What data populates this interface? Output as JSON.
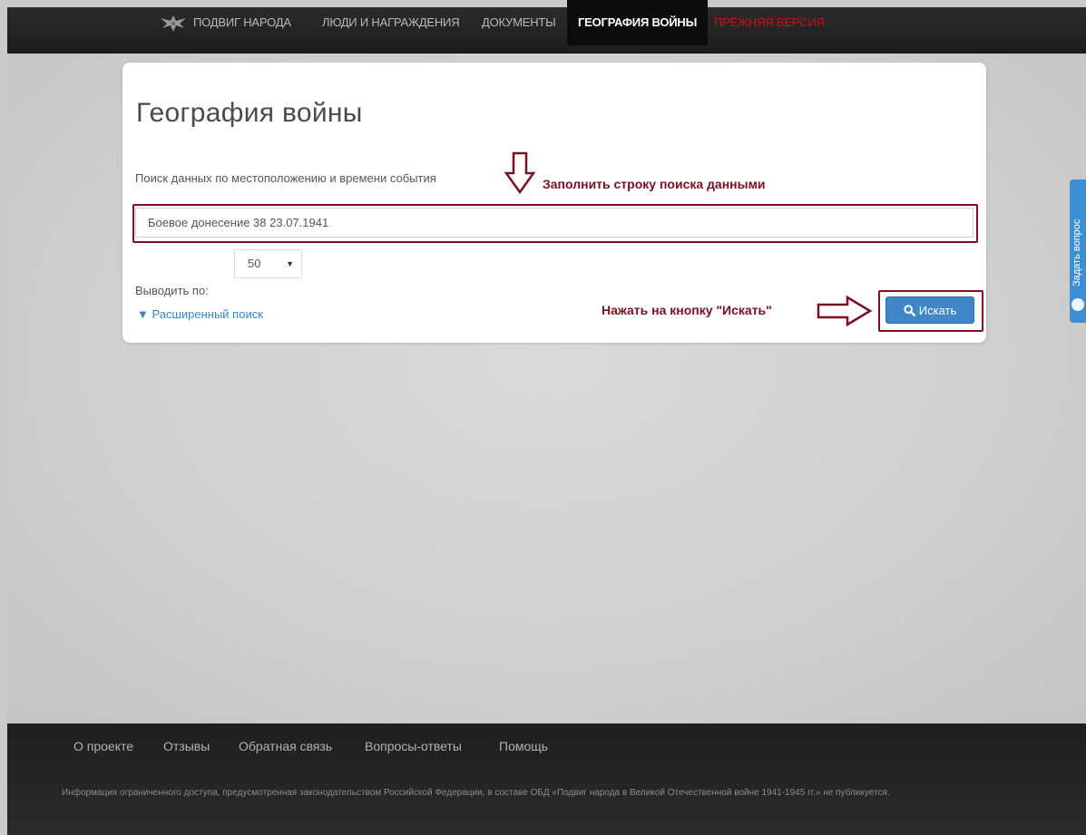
{
  "nav": {
    "items": [
      {
        "label": "ПОДВИГ НАРОДА"
      },
      {
        "label": "ЛЮДИ И НАГРАЖДЕНИЯ"
      },
      {
        "label": "ДОКУМЕНТЫ"
      },
      {
        "label": "ГЕОГРАФИЯ ВОЙНЫ"
      },
      {
        "label": "ПРЕЖНЯЯ ВЕРСИЯ"
      }
    ],
    "active_color": "#0c0c0c",
    "legacy_color": "#c0141b"
  },
  "main": {
    "title": "География войны",
    "search_label": "Поиск данных по местоположению и времени события",
    "search_value": "Боевое донесение 38 23.07.1941",
    "per_page_label": "Выводить по:",
    "per_page_value": "50",
    "advanced_search": "▼ Расширенный поиск",
    "search_button": "Искать"
  },
  "annotations": {
    "fill_hint": "Заполнить строку поиска данными",
    "click_hint": "Нажать на кнопку \"Искать\"",
    "color": "#7a1020"
  },
  "side_tab": {
    "label": "Задать вопрос",
    "color": "#3d8fd4"
  },
  "footer": {
    "links": [
      "О проекте",
      "Отзывы",
      "Обратная связь",
      "Вопросы-ответы",
      "Помощь"
    ],
    "note": "Информация ограниченного доступа, предусмотренная законодательством Российской Федерации, в составе ОБД «Подвиг народа в Великой Отечественной войне 1941-1945 гг.» не публикуется."
  },
  "icons": {
    "logo": "eagle-emblem-icon",
    "search": "search-icon",
    "question": "question-icon",
    "arrow_down": "arrow-down-icon",
    "arrow_right": "arrow-right-icon"
  }
}
